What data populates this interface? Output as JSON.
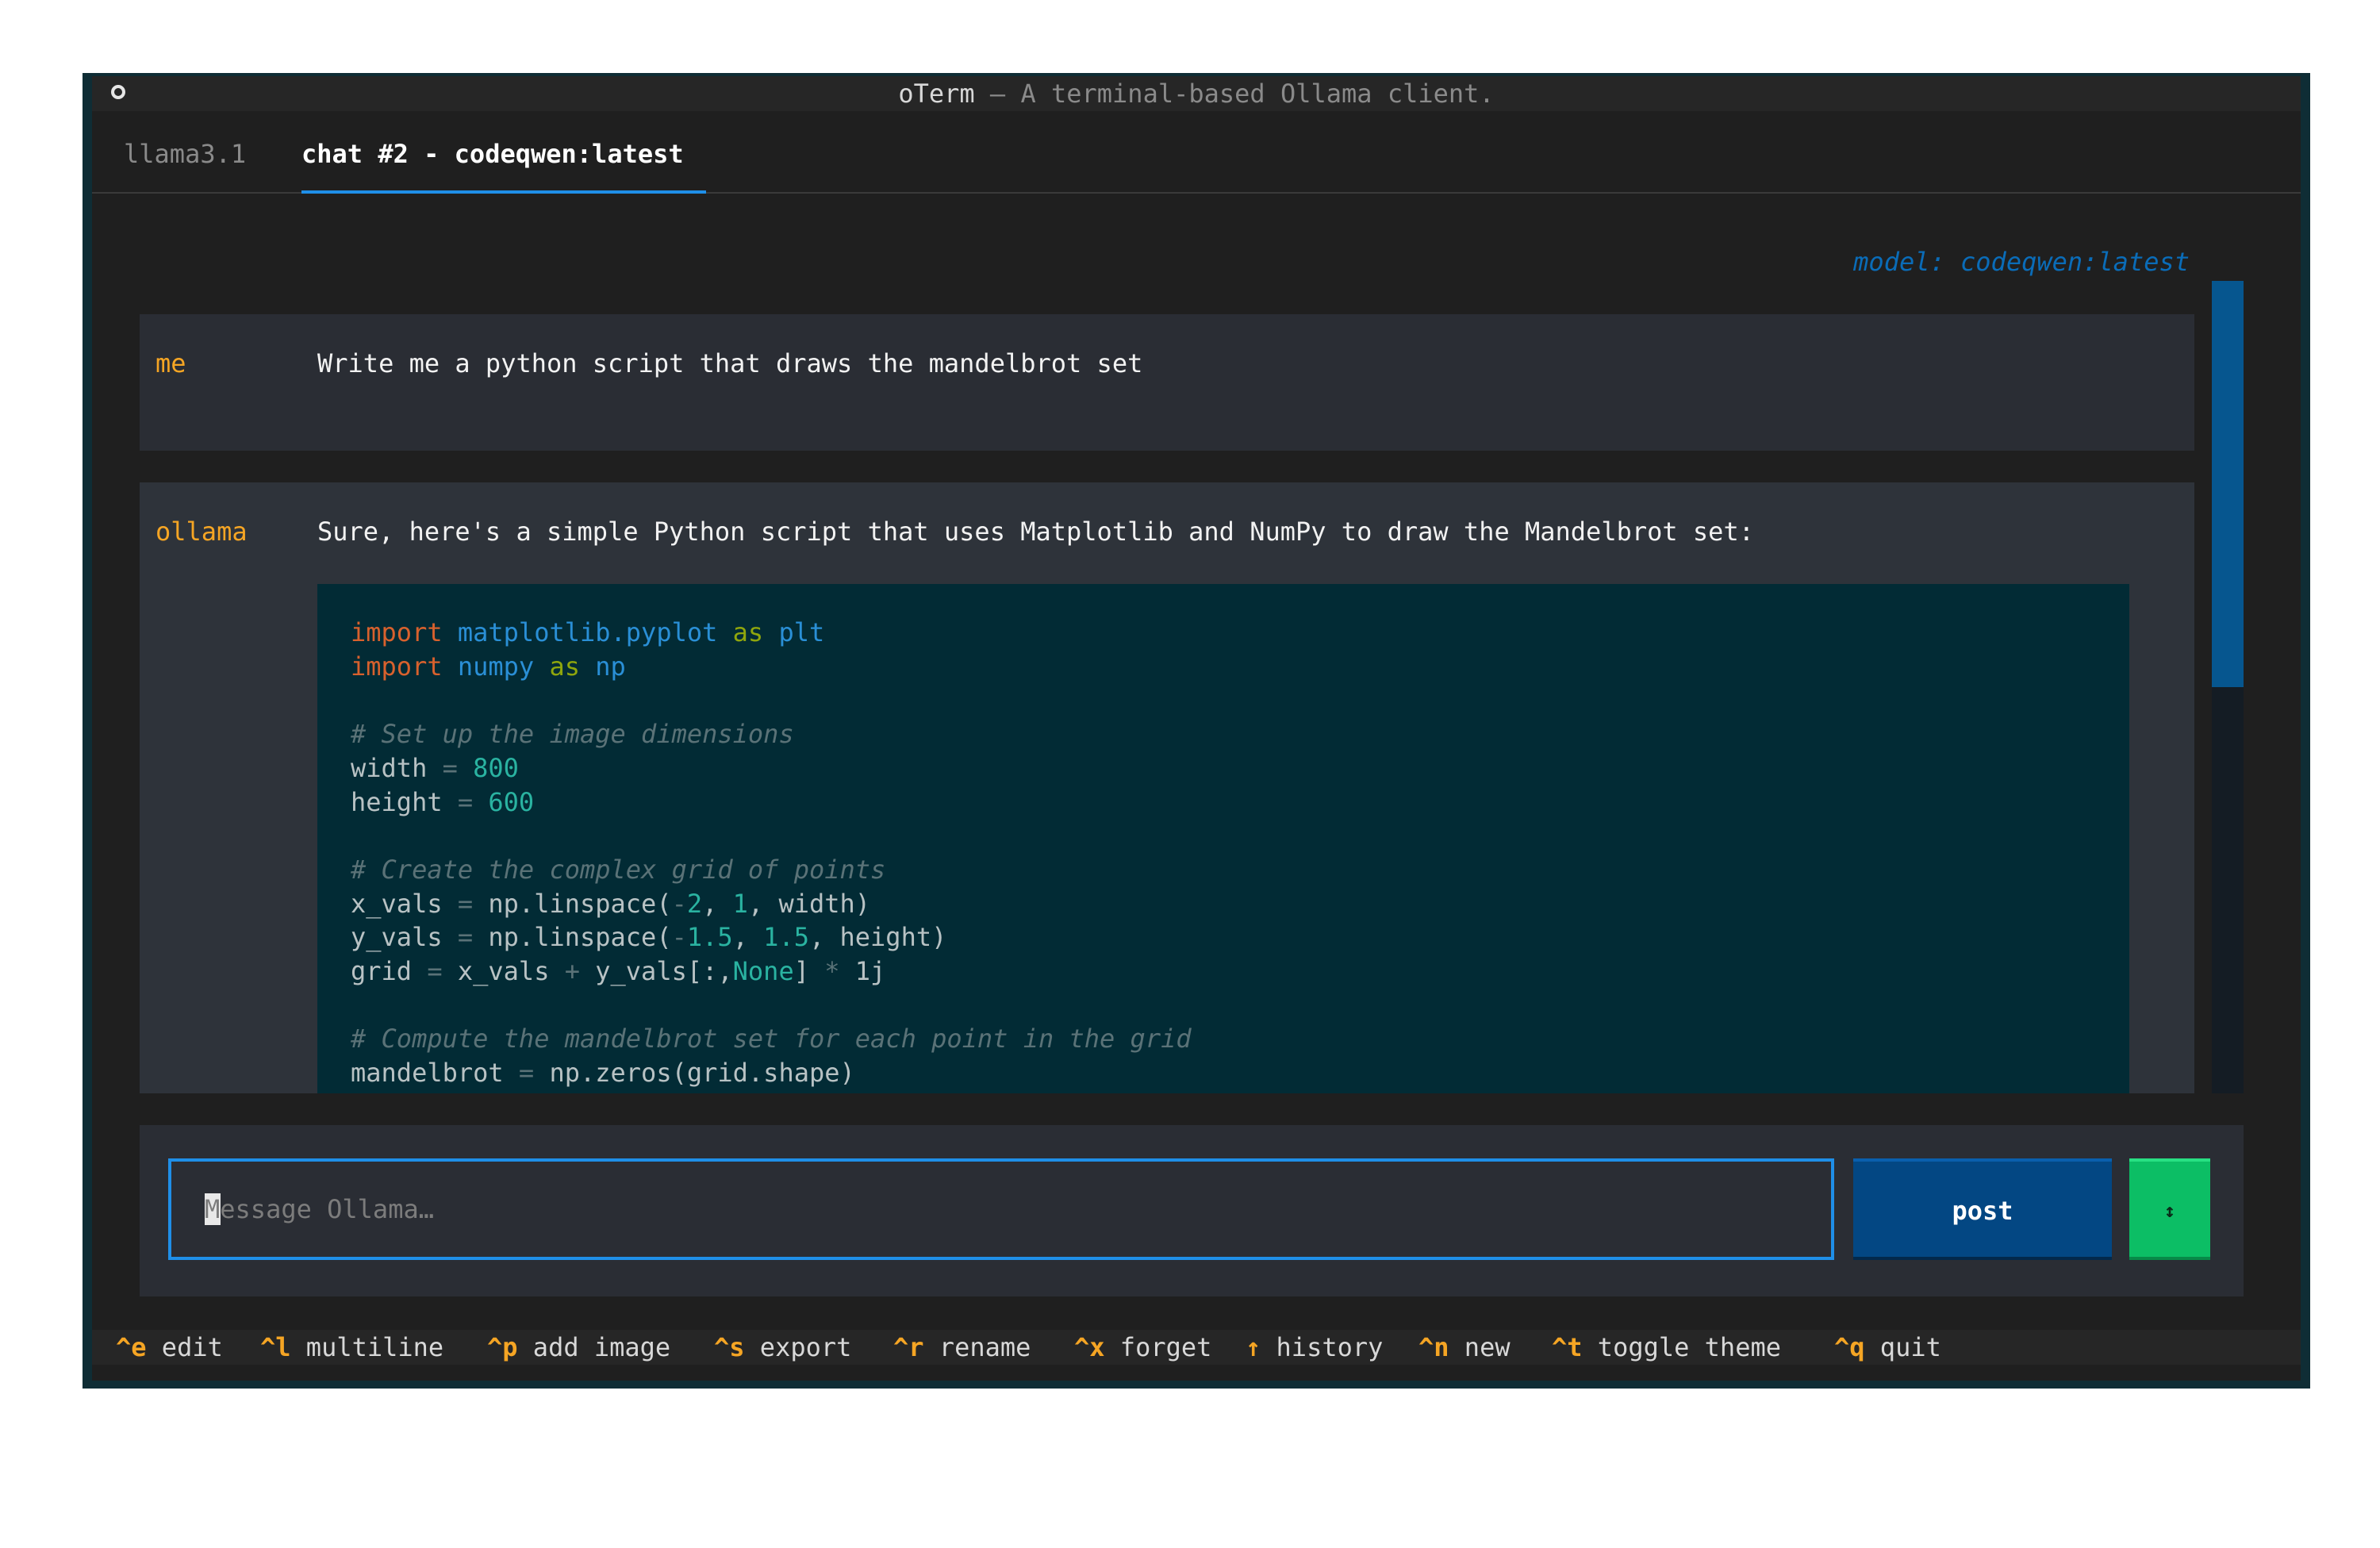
{
  "window": {
    "app_name": "oTerm",
    "subtitle": "— A terminal-based Ollama client."
  },
  "tabs": [
    {
      "label": "llama3.1",
      "active": false
    },
    {
      "label": "chat #2 - codeqwen:latest",
      "active": true
    }
  ],
  "model_label": "model: codeqwen:latest",
  "messages": [
    {
      "author": "me",
      "text": "Write me a python script that draws the mandelbrot set"
    },
    {
      "author": "ollama",
      "text": "Sure, here's a simple Python script that uses Matplotlib and NumPy to draw the Mandelbrot set:"
    }
  ],
  "code_lines": [
    "import matplotlib.pyplot as plt",
    "import numpy as np",
    "",
    "# Set up the image dimensions",
    "width = 800",
    "height = 600",
    "",
    "# Create the complex grid of points",
    "x_vals = np.linspace(-2, 1, width)",
    "y_vals = np.linspace(-1.5, 1.5, height)",
    "grid = x_vals + y_vals[:,None] * 1j",
    "",
    "# Compute the mandelbrot set for each point in the grid",
    "mandelbrot = np.zeros(grid.shape)"
  ],
  "composer": {
    "placeholder": "Message Ollama…",
    "post_label": "post",
    "toggle_label": "↕"
  },
  "footer": [
    {
      "key": "^e",
      "label": "edit"
    },
    {
      "key": "^l",
      "label": "multiline"
    },
    {
      "key": "^p",
      "label": "add image"
    },
    {
      "key": "^s",
      "label": "export"
    },
    {
      "key": "^r",
      "label": "rename"
    },
    {
      "key": "^x",
      "label": "forget"
    },
    {
      "key": "↑",
      "label": "history"
    },
    {
      "key": "^n",
      "label": "new"
    },
    {
      "key": "^t",
      "label": "toggle theme"
    },
    {
      "key": "^q",
      "label": "quit"
    }
  ],
  "colors": {
    "accent_blue": "#1f8fe8",
    "author_orange": "#f5a524",
    "post_button": "#034783",
    "toggle_button": "#0cbe65",
    "code_background": "#022b35"
  }
}
